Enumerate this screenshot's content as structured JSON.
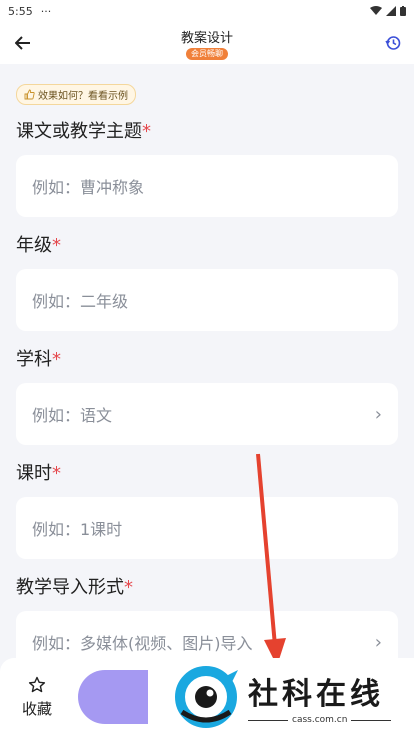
{
  "status": {
    "time": "5:55",
    "dots": "···"
  },
  "header": {
    "title": "教案设计",
    "badge": "会员畅聊"
  },
  "feedback": {
    "label": "效果如何？看看示例"
  },
  "fields": [
    {
      "label": "课文或教学主题",
      "required": "*",
      "placeholder": "例如：曹冲称象",
      "has_chevron": false
    },
    {
      "label": "年级",
      "required": "*",
      "placeholder": "例如：二年级",
      "has_chevron": false
    },
    {
      "label": "学科",
      "required": "*",
      "placeholder": "例如：语文",
      "has_chevron": true
    },
    {
      "label": "课时",
      "required": "*",
      "placeholder": "例如：1课时",
      "has_chevron": false
    },
    {
      "label": "教学导入形式",
      "required": "*",
      "placeholder": "例如：多媒体(视频、图片)导入",
      "has_chevron": true
    }
  ],
  "bottom": {
    "favorite_label": "收藏"
  },
  "watermark": {
    "text": "社科在线",
    "url": "cass.com.cn"
  },
  "colors": {
    "accent": "#a599f2",
    "badge": "#f0803a",
    "required": "#e5484d",
    "arrow": "#e5422f"
  }
}
